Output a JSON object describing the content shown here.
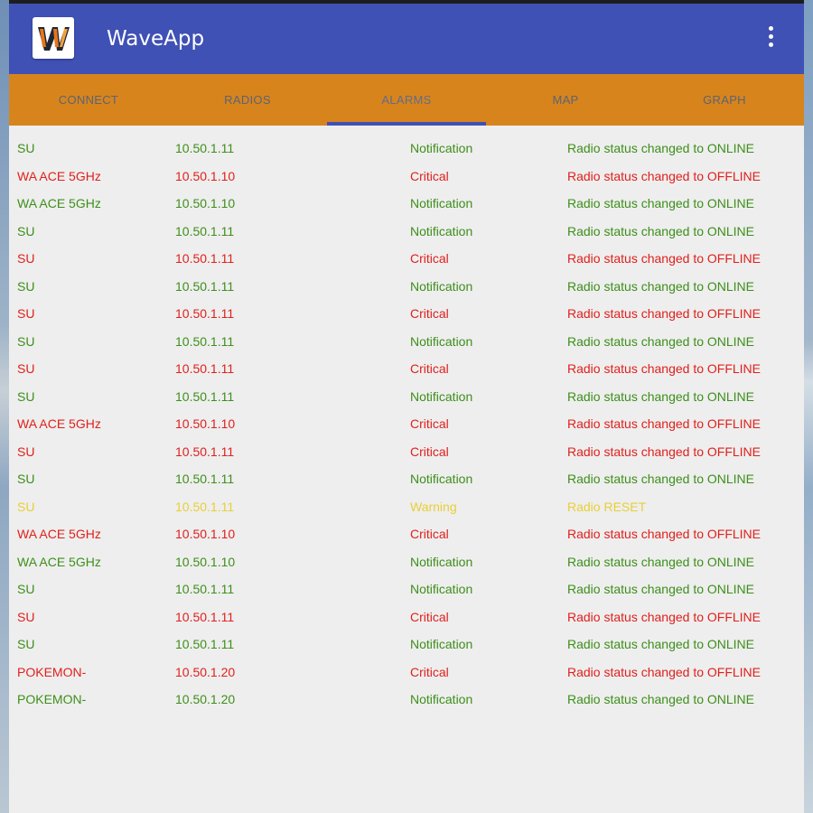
{
  "app": {
    "title": "WaveApp",
    "logo_letter": "W"
  },
  "colors": {
    "appbar": "#3f51b5",
    "tabbar": "#d8841d",
    "notification": "#3d8f1a",
    "critical": "#e0201c",
    "warning": "#e8cf35"
  },
  "menu": {
    "icon": "more-vert-icon"
  },
  "tabs": [
    {
      "label": "CONNECT"
    },
    {
      "label": "RADIOS"
    },
    {
      "label": "ALARMS",
      "active": true
    },
    {
      "label": "MAP"
    },
    {
      "label": "GRAPH"
    }
  ],
  "alarms": [
    {
      "name": "SU",
      "ip": "10.50.1.11",
      "severity": "Notification",
      "message": "Radio status changed to ONLINE"
    },
    {
      "name": "WA ACE 5GHz",
      "ip": "10.50.1.10",
      "severity": "Critical",
      "message": "Radio status changed to OFFLINE"
    },
    {
      "name": "WA ACE 5GHz",
      "ip": "10.50.1.10",
      "severity": "Notification",
      "message": "Radio status changed to ONLINE"
    },
    {
      "name": "SU",
      "ip": "10.50.1.11",
      "severity": "Notification",
      "message": "Radio status changed to ONLINE"
    },
    {
      "name": "SU",
      "ip": "10.50.1.11",
      "severity": "Critical",
      "message": "Radio status changed to OFFLINE"
    },
    {
      "name": "SU",
      "ip": "10.50.1.11",
      "severity": "Notification",
      "message": "Radio status changed to ONLINE"
    },
    {
      "name": "SU",
      "ip": "10.50.1.11",
      "severity": "Critical",
      "message": "Radio status changed to OFFLINE"
    },
    {
      "name": "SU",
      "ip": "10.50.1.11",
      "severity": "Notification",
      "message": "Radio status changed to ONLINE"
    },
    {
      "name": "SU",
      "ip": "10.50.1.11",
      "severity": "Critical",
      "message": "Radio status changed to OFFLINE"
    },
    {
      "name": "SU",
      "ip": "10.50.1.11",
      "severity": "Notification",
      "message": "Radio status changed to ONLINE"
    },
    {
      "name": "WA ACE 5GHz",
      "ip": "10.50.1.10",
      "severity": "Critical",
      "message": "Radio status changed to OFFLINE"
    },
    {
      "name": "SU",
      "ip": "10.50.1.11",
      "severity": "Critical",
      "message": "Radio status changed to OFFLINE"
    },
    {
      "name": "SU",
      "ip": "10.50.1.11",
      "severity": "Notification",
      "message": "Radio status changed to ONLINE"
    },
    {
      "name": "SU",
      "ip": "10.50.1.11",
      "severity": "Warning",
      "message": "Radio RESET"
    },
    {
      "name": "WA ACE 5GHz",
      "ip": "10.50.1.10",
      "severity": "Critical",
      "message": "Radio status changed to OFFLINE"
    },
    {
      "name": "WA ACE 5GHz",
      "ip": "10.50.1.10",
      "severity": "Notification",
      "message": "Radio status changed to ONLINE"
    },
    {
      "name": "SU",
      "ip": "10.50.1.11",
      "severity": "Notification",
      "message": "Radio status changed to ONLINE"
    },
    {
      "name": "SU",
      "ip": "10.50.1.11",
      "severity": "Critical",
      "message": "Radio status changed to OFFLINE"
    },
    {
      "name": "SU",
      "ip": "10.50.1.11",
      "severity": "Notification",
      "message": "Radio status changed to ONLINE"
    },
    {
      "name": "POKEMON-",
      "ip": "10.50.1.20",
      "severity": "Critical",
      "message": "Radio status changed to OFFLINE"
    },
    {
      "name": "POKEMON-",
      "ip": "10.50.1.20",
      "severity": "Notification",
      "message": "Radio status changed to ONLINE"
    }
  ]
}
